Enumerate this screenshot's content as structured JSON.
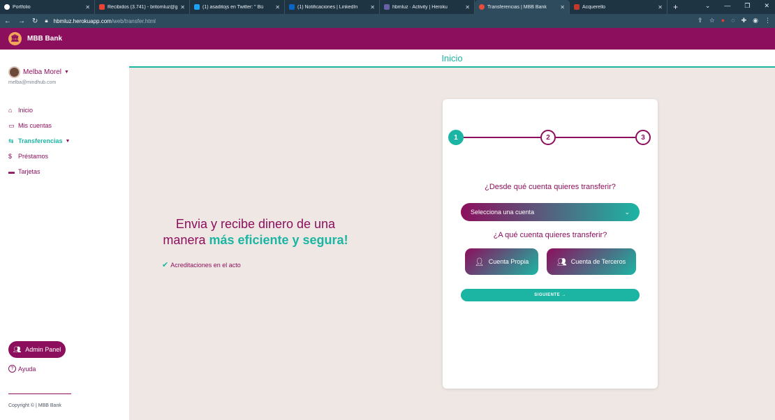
{
  "browser": {
    "tabs": [
      {
        "title": "Portfolio",
        "color": "#ffffff"
      },
      {
        "title": "Recibidos (3.741) - britomluz@g",
        "color": "#ea4335"
      },
      {
        "title": "(1) asaditojs en Twitter: \" Bú",
        "color": "#1da1f2"
      },
      {
        "title": "(1) Notificaciones | LinkedIn",
        "color": "#0a66c2"
      },
      {
        "title": "hbmluz · Activity | Heroku",
        "color": "#6762a6"
      },
      {
        "title": "Transferencias | MBB Bank",
        "color": "#e74c3c"
      },
      {
        "title": "Acquerello",
        "color": "#c0392b"
      }
    ],
    "active_tab_index": 5,
    "new_tab": "+",
    "url_host": "hbmluz.herokuapp.com",
    "url_path": "/web/transfer.html"
  },
  "app": {
    "brand": "MBB Bank",
    "brand_color": "#8c0f5d",
    "accent_color": "#1cb5a3"
  },
  "sidebar": {
    "user_name": "Melba Morel",
    "user_email": "melba@mindhub.com",
    "items": [
      {
        "label": "Inicio",
        "icon": "home-icon",
        "active": false
      },
      {
        "label": "Mis cuentas",
        "icon": "card-icon",
        "active": false
      },
      {
        "label": "Transferencias",
        "icon": "transfer-icon",
        "active": true
      },
      {
        "label": "Préstamos",
        "icon": "dollar-icon",
        "active": false
      },
      {
        "label": "Tarjetas",
        "icon": "credit-card-icon",
        "active": false
      }
    ],
    "admin_label": "Admin Panel",
    "help_label": "Ayuda",
    "copyright": "Copyright © | MBB Bank"
  },
  "main": {
    "header": "Inicio",
    "hero_line1": "Envia y recibe dinero de una",
    "hero_line2_plain": "manera ",
    "hero_line2_bold": "más eficiente y segura!",
    "feature": "Acreditaciones en el acto"
  },
  "transfer": {
    "steps": [
      "1",
      "2",
      "3"
    ],
    "current_step": 1,
    "question_from": "¿Desde qué cuenta quieres transferir?",
    "select_placeholder": "Selecciona una cuenta",
    "question_to": "¿A qué cuenta quieres transferir?",
    "option_own": "Cuenta Propia",
    "option_third": "Cuenta de Terceros",
    "next_label": "SIGUIENTE →"
  }
}
